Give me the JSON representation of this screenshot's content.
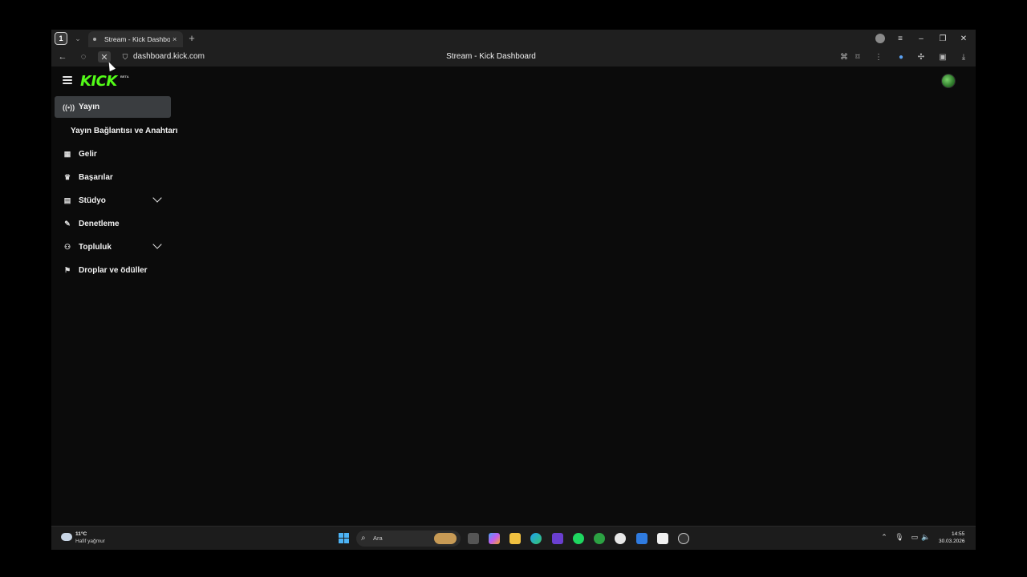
{
  "browser": {
    "tab_counter": "1",
    "tab_title": "Stream - Kick Dashboar",
    "tab_close": "×",
    "new_tab": "+",
    "url": "dashboard.kick.com",
    "page_title": "Stream - Kick Dashboard"
  },
  "logo": {
    "text": "KICK",
    "badge": "BETA",
    "color": "#53fc18"
  },
  "sidebar": {
    "items": [
      {
        "label": "Yayın",
        "icon": "broadcast-icon",
        "active": true
      },
      {
        "label": "Yayın Bağlantısı ve Anahtarı",
        "icon": "",
        "sub": true
      },
      {
        "label": "Gelir",
        "icon": "chart-icon"
      },
      {
        "label": "Başarılar",
        "icon": "trophy-icon"
      },
      {
        "label": "Stüdyo",
        "icon": "studio-icon",
        "expandable": true
      },
      {
        "label": "Denetleme",
        "icon": "wrench-icon"
      },
      {
        "label": "Topluluk",
        "icon": "users-icon",
        "expandable": true
      },
      {
        "label": "Droplar ve ödüller",
        "icon": "gift-icon"
      }
    ]
  },
  "taskbar": {
    "weather_temp": "11°C",
    "weather_desc": "Hafif yağmur",
    "search_placeholder": "Ara",
    "time": "14:55",
    "date": "30.03.2026"
  }
}
